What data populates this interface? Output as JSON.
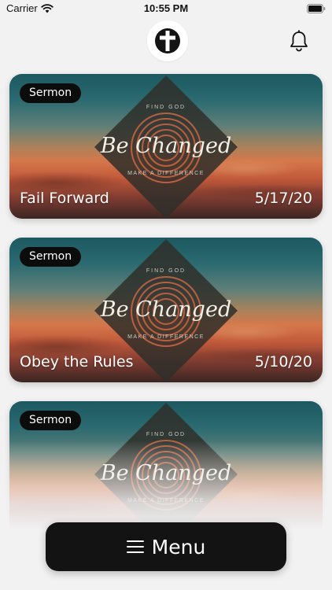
{
  "status_bar": {
    "carrier": "Carrier",
    "time": "10:55 PM"
  },
  "header": {
    "logo_icon": "cross-logo-icon",
    "notification_icon": "bell-icon"
  },
  "emblem": {
    "title": "Be Changed",
    "top_text": "FIND GOD",
    "bottom_text": "MAKE A DIFFERENCE"
  },
  "sermons": [
    {
      "badge": "Sermon",
      "title": "Fail Forward",
      "date": "5/17/20"
    },
    {
      "badge": "Sermon",
      "title": "Obey the Rules",
      "date": "5/10/20"
    },
    {
      "badge": "Sermon"
    }
  ],
  "menu": {
    "label": "Menu",
    "icon": "hamburger-icon"
  },
  "colors": {
    "accent_dark": "#131313",
    "badge_bg": "#0c0c0c",
    "background": "#f2f2f2"
  }
}
